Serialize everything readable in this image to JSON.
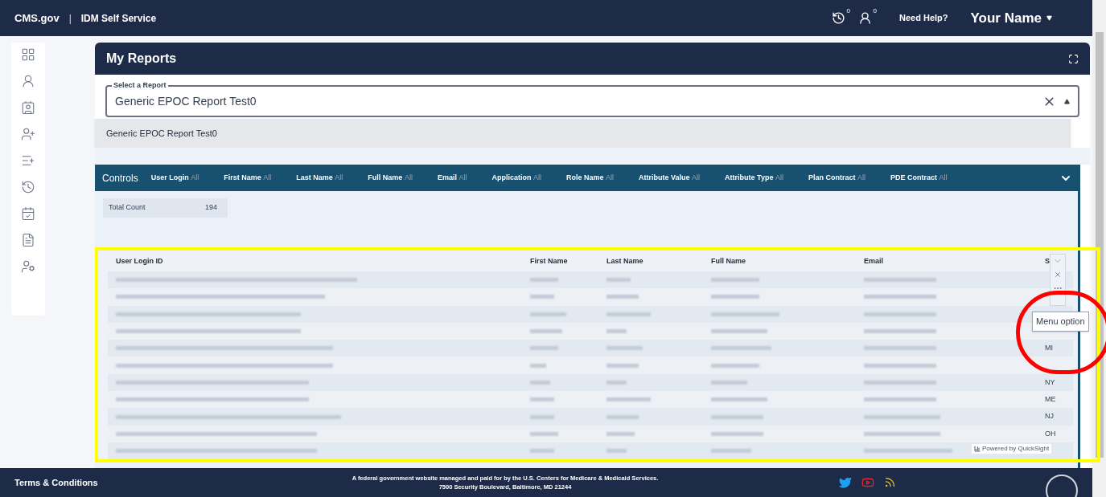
{
  "header": {
    "brand": "CMS.gov",
    "separator": "|",
    "app_title": "IDM Self Service",
    "badges": [
      {
        "count": "0"
      },
      {
        "count": "0"
      }
    ],
    "help": "Need Help?",
    "user": "Your Name"
  },
  "sidebar": {
    "items": [
      {
        "kind": "grid"
      },
      {
        "kind": "user"
      },
      {
        "kind": "contact"
      },
      {
        "kind": "user-plus"
      },
      {
        "kind": "user-list"
      },
      {
        "kind": "user-clock"
      },
      {
        "kind": "calendar"
      },
      {
        "kind": "file"
      },
      {
        "kind": "user-cog"
      }
    ]
  },
  "panel": {
    "title": "My Reports",
    "select": {
      "label": "Select a Report",
      "value": "Generic EPOC Report Test0",
      "expanded": true,
      "options": [
        "Generic EPOC Report Test0"
      ]
    },
    "controls": {
      "title": "Controls",
      "filters": [
        {
          "label": "User Login",
          "value": "All"
        },
        {
          "label": "First Name",
          "value": "All"
        },
        {
          "label": "Last Name",
          "value": "All"
        },
        {
          "label": "Full Name",
          "value": "All"
        },
        {
          "label": "Email",
          "value": "All"
        },
        {
          "label": "Application",
          "value": "All"
        },
        {
          "label": "Role Name",
          "value": "All"
        },
        {
          "label": "Attribute Value",
          "value": "All"
        },
        {
          "label": "Attribute Type",
          "value": "All"
        },
        {
          "label": "Plan Contract",
          "value": "All"
        },
        {
          "label": "PDE Contract",
          "value": "All"
        }
      ]
    },
    "total_count": {
      "label": "Total Count",
      "value": "194"
    },
    "table": {
      "columns": [
        "User Login ID",
        "First Name",
        "Last Name",
        "Full Name",
        "Email",
        "S"
      ],
      "rows": [
        {
          "kind": "blurred"
        },
        {
          "kind": "blurred"
        },
        {
          "kind": "blurred"
        },
        {
          "kind": "blurred"
        },
        {
          "kind": "blurred",
          "state": "MI"
        },
        {
          "kind": "blurred"
        },
        {
          "kind": "blurred",
          "state": "NY"
        },
        {
          "kind": "blurred",
          "state": "ME"
        },
        {
          "kind": "blurred",
          "state": "NJ"
        },
        {
          "kind": "blurred",
          "state": "OH"
        },
        {
          "kind": "blurred"
        }
      ]
    },
    "tooltip": "Menu option",
    "powered_by": "Powered by QuickSight"
  },
  "footer": {
    "terms": "Terms & Conditions",
    "notice": "A federal government website managed and paid for by the U.S. Centers for Medicare & Medicaid Services.",
    "address": "7500 Security Boulevard, Baltimore, MD 21244"
  },
  "annotations": [
    {
      "kind": "rectangle",
      "color": "#ffff00"
    },
    {
      "kind": "circle",
      "color": "#ff0000"
    }
  ]
}
